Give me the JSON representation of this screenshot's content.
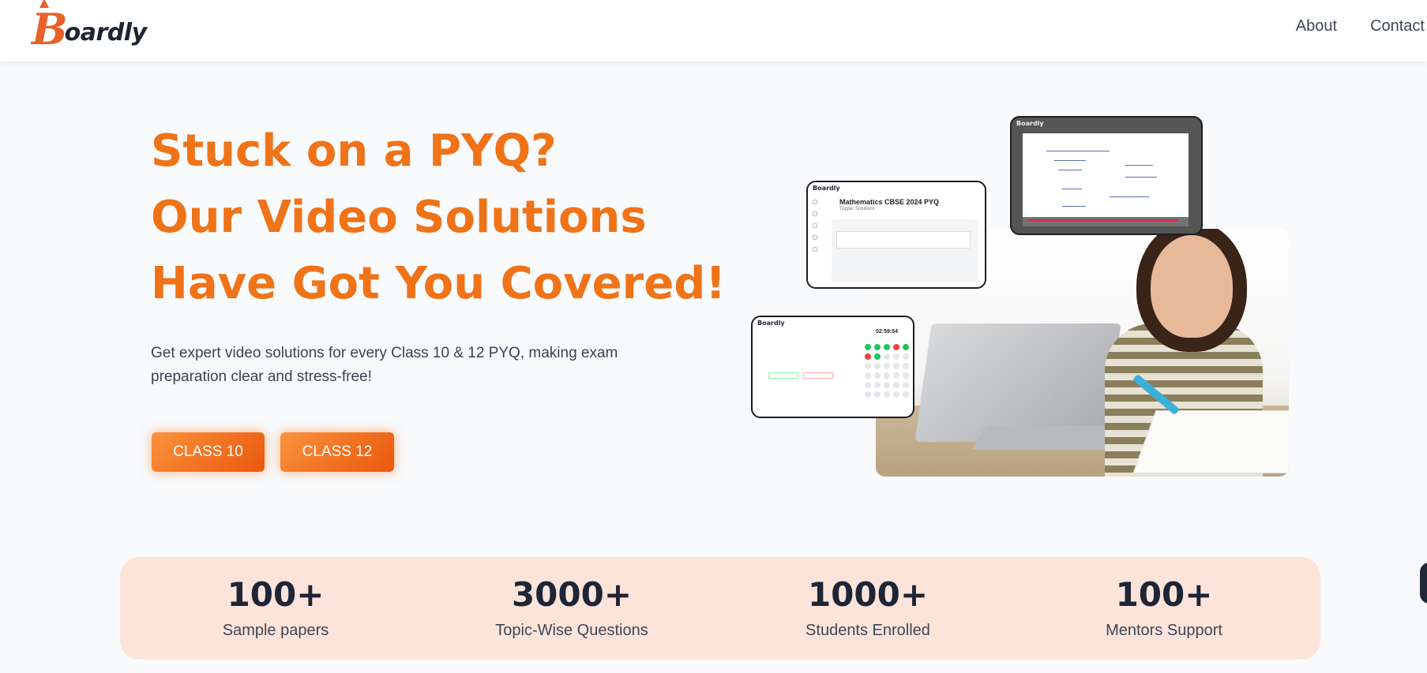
{
  "header": {
    "logo_letter": "B",
    "logo_text": "oardly",
    "nav": [
      "About",
      "Contact"
    ]
  },
  "hero": {
    "title_lines": [
      "Stuck on a PYQ?",
      "Our Video Solutions",
      "Have Got You Covered!"
    ],
    "subtitle_line1": "Get expert video solutions for every Class 10 & 12 PYQ, making exam",
    "subtitle_line2": "preparation clear and stress-free!",
    "buttons": [
      "CLASS 10",
      "CLASS 12"
    ]
  },
  "preview_cards": {
    "paper_title": "Mathematics CBSE 2024 PYQ",
    "paper_subtitle": "Topper Solutions",
    "test_timer": "02:59:54",
    "mini_logo": "Boardly"
  },
  "stats": [
    {
      "value": "100+",
      "label": "Sample papers"
    },
    {
      "value": "3000+",
      "label": "Topic-Wise Questions"
    },
    {
      "value": "1000+",
      "label": "Students Enrolled"
    },
    {
      "value": "100+",
      "label": "Mentors Support"
    }
  ],
  "colors": {
    "accent": "#f07318",
    "band": "#fde4da",
    "text_dark": "#1e2535"
  }
}
